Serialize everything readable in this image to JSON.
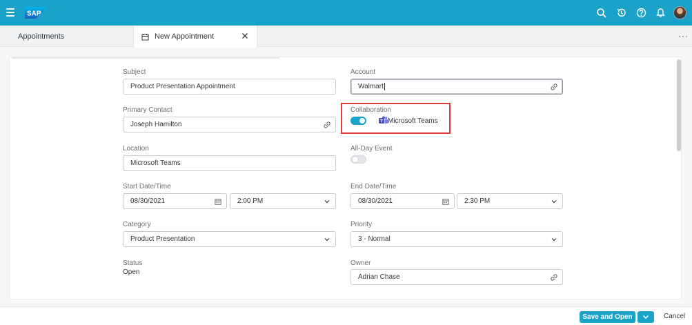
{
  "tabs": [
    {
      "label": "Appointments"
    },
    {
      "label": "New Appointment"
    }
  ],
  "form": {
    "subject": {
      "label": "Subject",
      "value": "Product Presentation Appointment"
    },
    "account": {
      "label": "Account",
      "value": "Walmart"
    },
    "primary_contact": {
      "label": "Primary Contact",
      "value": "Joseph Hamilton"
    },
    "collaboration": {
      "label": "Collaboration",
      "enabled": true,
      "app": "Microsoft Teams"
    },
    "location": {
      "label": "Location",
      "value": "Microsoft Teams"
    },
    "all_day": {
      "label": "All-Day Event",
      "enabled": false
    },
    "start": {
      "label": "Start Date/Time",
      "date": "08/30/2021",
      "time": "2:00 PM"
    },
    "end": {
      "label": "End Date/Time",
      "date": "08/30/2021",
      "time": "2:30 PM"
    },
    "category": {
      "label": "Category",
      "value": "Product Presentation"
    },
    "priority": {
      "label": "Priority",
      "value": "3 - Normal"
    },
    "status": {
      "label": "Status",
      "value": "Open"
    },
    "owner": {
      "label": "Owner",
      "value": "Adrian Chase"
    }
  },
  "footer": {
    "save_label": "Save and Open",
    "cancel_label": "Cancel"
  },
  "colors": {
    "shell": "#1ba2c8",
    "highlight": "#e03a3a",
    "teams": "#5b5fc7"
  }
}
